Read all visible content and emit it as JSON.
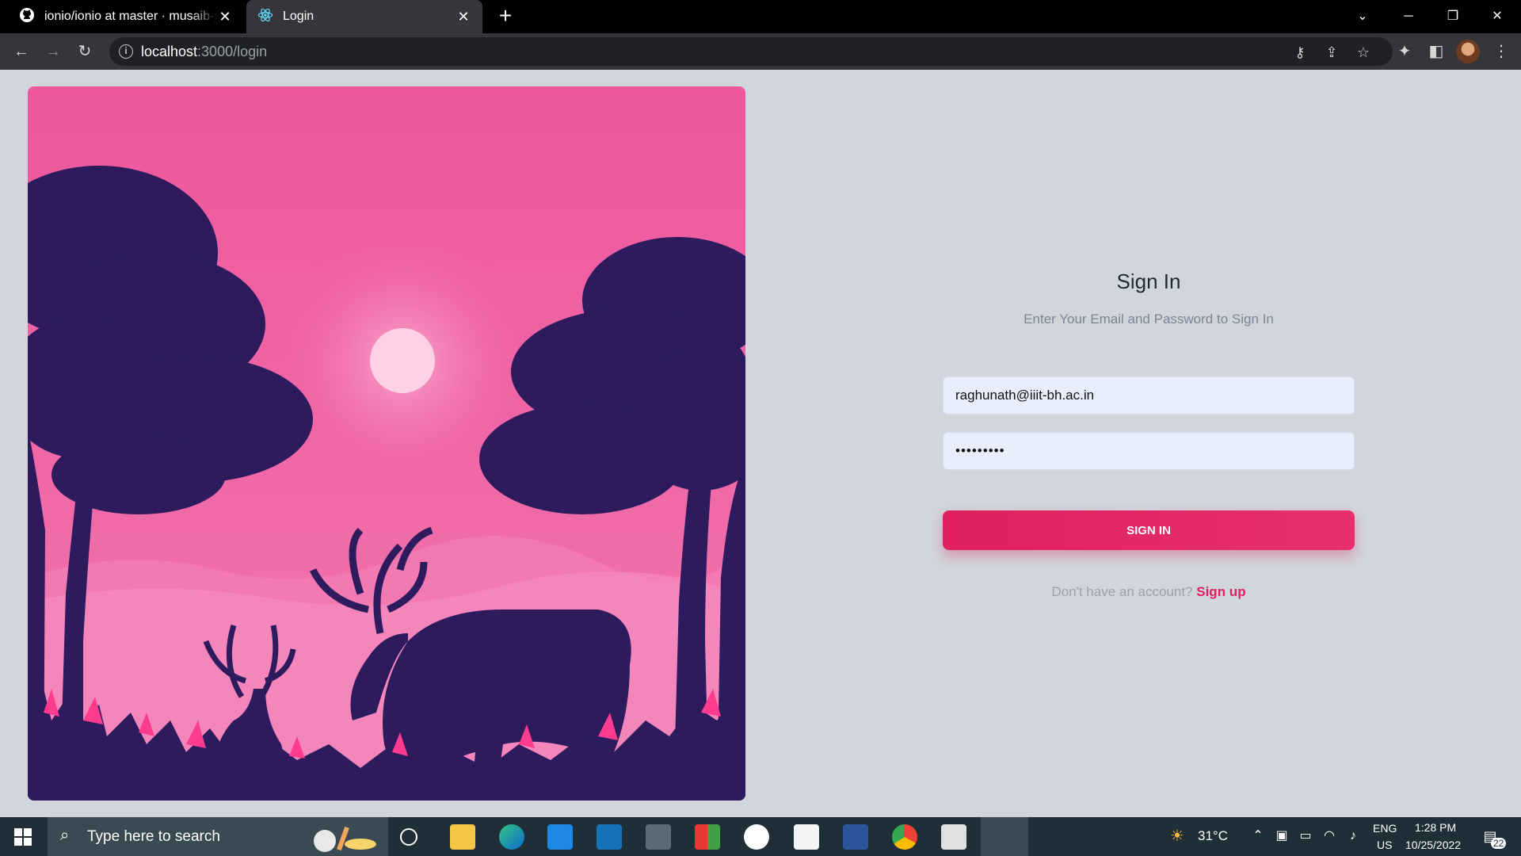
{
  "browser": {
    "tabs": [
      {
        "title": "ionio/ionio at master · musaib-js/",
        "icon": "github-icon"
      },
      {
        "title": "Login",
        "icon": "react-icon"
      }
    ],
    "url_host": "localhost",
    "url_path": ":3000/login"
  },
  "login": {
    "heading": "Sign In",
    "subtitle": "Enter Your Email and Password to Sign In",
    "email_value": "raghunath@iiit-bh.ac.in",
    "password_value": "•••••••••",
    "submit_label": "SIGN IN",
    "signup_prompt": "Don't have an account?",
    "signup_link": "Sign up"
  },
  "colors": {
    "accent": "#e0205f",
    "page_bg": "#d1d5dc",
    "hero_pink": "#ef5a9e",
    "hero_silhouette": "#2d1b5e"
  },
  "taskbar": {
    "search_placeholder": "Type here to search",
    "weather": "31°C",
    "language": "ENG",
    "region": "US",
    "time": "1:28 PM",
    "date": "10/25/2022",
    "notifications": "22"
  }
}
